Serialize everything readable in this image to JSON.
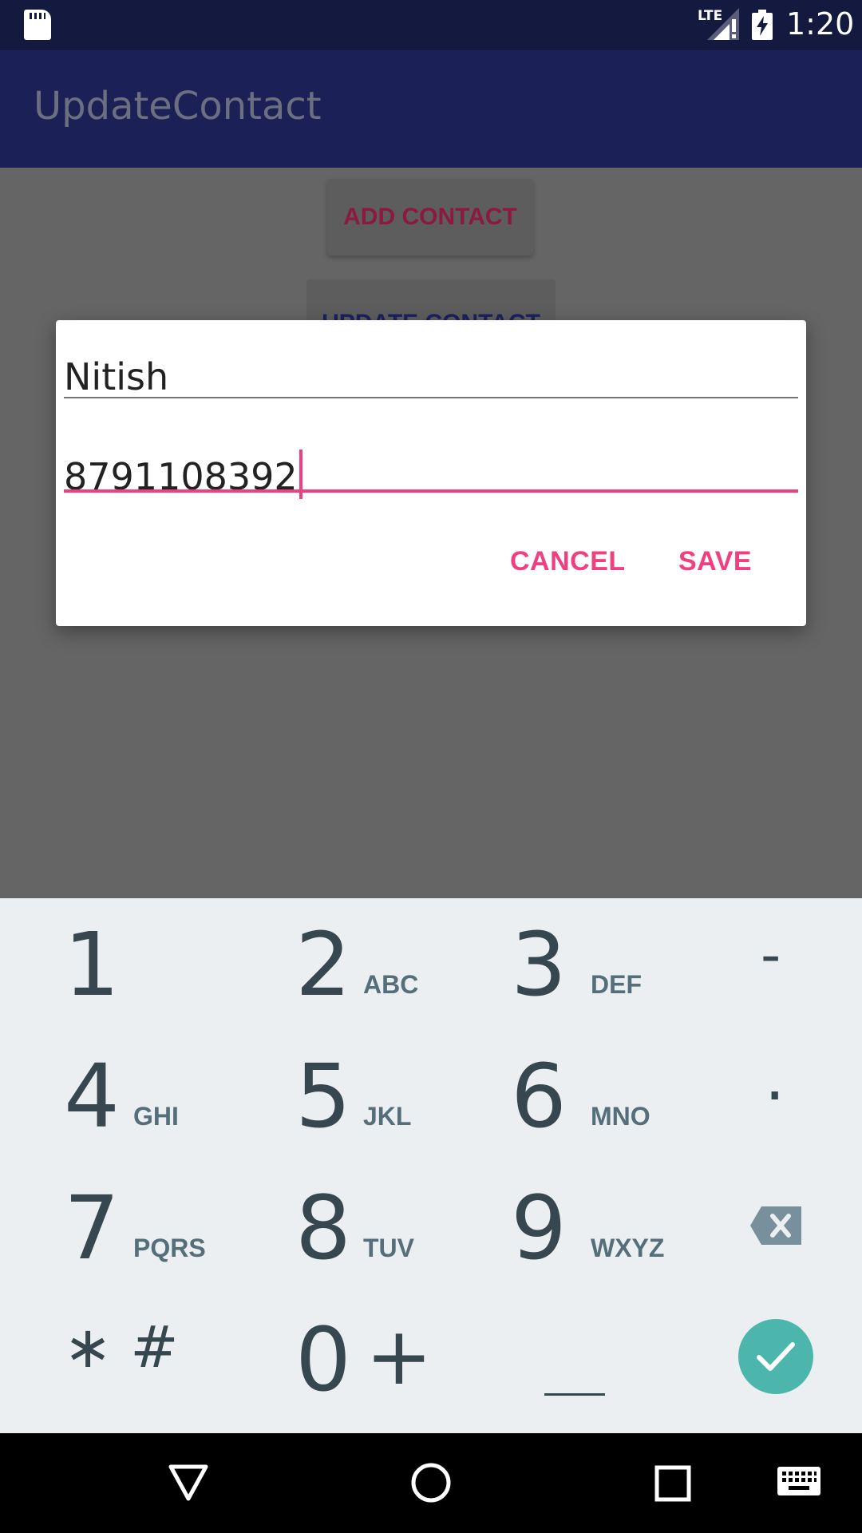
{
  "status_bar": {
    "network_label": "LTE",
    "time": "1:20"
  },
  "app_bar": {
    "title": "UpdateContact"
  },
  "content": {
    "add_contact_label": "ADD CONTACT",
    "update_contact_label": "UPDATE CONTACT"
  },
  "dialog": {
    "name_value": "Nitish",
    "phone_value": "8791108392",
    "cancel_label": "CANCEL",
    "save_label": "SAVE",
    "accent_color": "#ef4081"
  },
  "keyboard": {
    "keys": [
      {
        "digit": "1",
        "letters": ""
      },
      {
        "digit": "2",
        "letters": "ABC"
      },
      {
        "digit": "3",
        "letters": "DEF"
      },
      {
        "digit": "4",
        "letters": "GHI"
      },
      {
        "digit": "5",
        "letters": "JKL"
      },
      {
        "digit": "6",
        "letters": "MNO"
      },
      {
        "digit": "7",
        "letters": "PQRS"
      },
      {
        "digit": "8",
        "letters": "TUV"
      },
      {
        "digit": "9",
        "letters": "WXYZ"
      },
      {
        "digit": "0",
        "letters": "+"
      }
    ],
    "symbols": {
      "dash": "-",
      "dot": ".",
      "star_hash": "∗ #",
      "space": "__"
    },
    "done_icon": "check-icon",
    "done_color": "#4db6ac"
  },
  "nav_bar": {
    "icons": [
      "back-icon",
      "home-icon",
      "recents-icon",
      "keyboard-icon"
    ]
  }
}
